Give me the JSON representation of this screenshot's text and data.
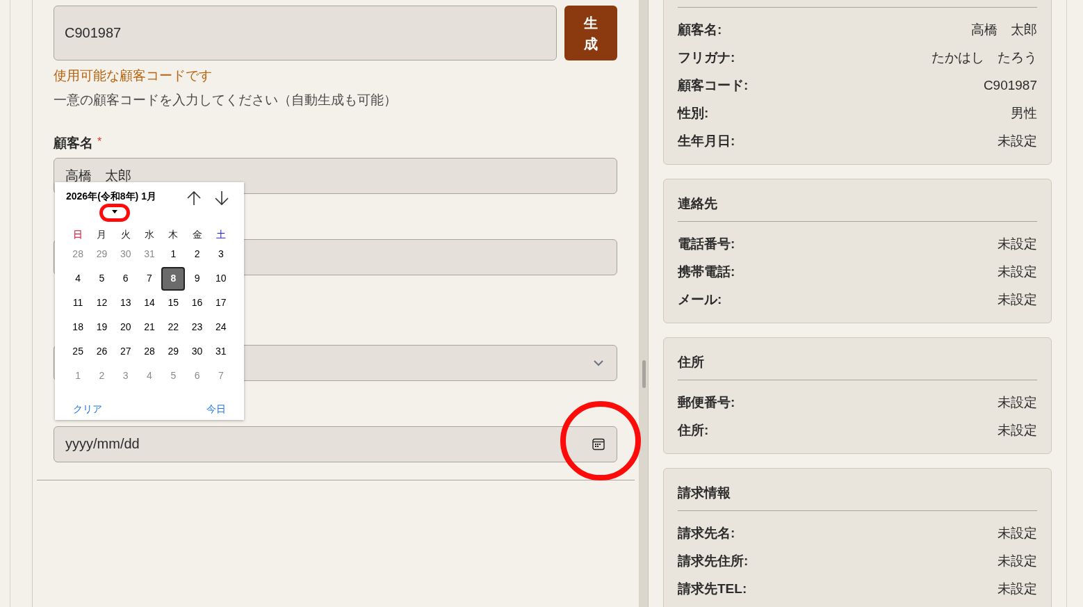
{
  "customer_code": {
    "value": "C901987",
    "generate_button": "生成",
    "status": "使用可能な顧客コードです",
    "help": "一意の顧客コードを入力してください（自動生成も可能）"
  },
  "customer_name": {
    "label": "顧客名",
    "required_mark": "*",
    "value": "高橋　太郎"
  },
  "fields": [
    {
      "kind": "text"
    },
    {
      "kind": "select"
    },
    {
      "kind": "date",
      "placeholder": "yyyy/mm/dd"
    }
  ],
  "calendar": {
    "header": "2026年(令和8年) 1月",
    "weekdays": [
      {
        "label": "日",
        "color": "#e0002b"
      },
      {
        "label": "月"
      },
      {
        "label": "火"
      },
      {
        "label": "水"
      },
      {
        "label": "木"
      },
      {
        "label": "金"
      },
      {
        "label": "土",
        "color": "#1a1aff"
      }
    ],
    "weeks": [
      [
        {
          "day": "28",
          "outside": true,
          "selected": false
        },
        {
          "day": "29",
          "outside": true,
          "selected": false
        },
        {
          "day": "30",
          "outside": true,
          "selected": false
        },
        {
          "day": "31",
          "outside": true,
          "selected": false
        },
        {
          "day": "1",
          "outside": false,
          "selected": false
        },
        {
          "day": "2",
          "outside": false,
          "selected": false
        },
        {
          "day": "3",
          "outside": false,
          "selected": false
        }
      ],
      [
        {
          "day": "4",
          "outside": false,
          "selected": false
        },
        {
          "day": "5",
          "outside": false,
          "selected": false
        },
        {
          "day": "6",
          "outside": false,
          "selected": false
        },
        {
          "day": "7",
          "outside": false,
          "selected": false
        },
        {
          "day": "8",
          "outside": false,
          "selected": true
        },
        {
          "day": "9",
          "outside": false,
          "selected": false
        },
        {
          "day": "10",
          "outside": false,
          "selected": false
        }
      ],
      [
        {
          "day": "11",
          "outside": false,
          "selected": false
        },
        {
          "day": "12",
          "outside": false,
          "selected": false
        },
        {
          "day": "13",
          "outside": false,
          "selected": false
        },
        {
          "day": "14",
          "outside": false,
          "selected": false
        },
        {
          "day": "15",
          "outside": false,
          "selected": false
        },
        {
          "day": "16",
          "outside": false,
          "selected": false
        },
        {
          "day": "17",
          "outside": false,
          "selected": false
        }
      ],
      [
        {
          "day": "18",
          "outside": false,
          "selected": false
        },
        {
          "day": "19",
          "outside": false,
          "selected": false
        },
        {
          "day": "20",
          "outside": false,
          "selected": false
        },
        {
          "day": "21",
          "outside": false,
          "selected": false
        },
        {
          "day": "22",
          "outside": false,
          "selected": false
        },
        {
          "day": "23",
          "outside": false,
          "selected": false
        },
        {
          "day": "24",
          "outside": false,
          "selected": false
        }
      ],
      [
        {
          "day": "25",
          "outside": false,
          "selected": false
        },
        {
          "day": "26",
          "outside": false,
          "selected": false
        },
        {
          "day": "27",
          "outside": false,
          "selected": false
        },
        {
          "day": "28",
          "outside": false,
          "selected": false
        },
        {
          "day": "29",
          "outside": false,
          "selected": false
        },
        {
          "day": "30",
          "outside": false,
          "selected": false
        },
        {
          "day": "31",
          "outside": false,
          "selected": false
        }
      ],
      [
        {
          "day": "1",
          "outside": true,
          "selected": false
        },
        {
          "day": "2",
          "outside": true,
          "selected": false
        },
        {
          "day": "3",
          "outside": true,
          "selected": false
        },
        {
          "day": "4",
          "outside": true,
          "selected": false
        },
        {
          "day": "5",
          "outside": true,
          "selected": false
        },
        {
          "day": "6",
          "outside": true,
          "selected": false
        },
        {
          "day": "7",
          "outside": true,
          "selected": false
        }
      ]
    ],
    "clear": "クリア",
    "today": "今日"
  },
  "summary_cards": [
    {
      "rows": [
        {
          "label": "顧客名:",
          "value": "高橋　太郎"
        },
        {
          "label": "フリガナ:",
          "value": "たかはし　たろう"
        },
        {
          "label": "顧客コード:",
          "value": "C901987"
        },
        {
          "label": "性別:",
          "value": "男性"
        },
        {
          "label": "生年月日:",
          "value": "未設定"
        }
      ]
    },
    {
      "title": "連絡先",
      "rows": [
        {
          "label": "電話番号:",
          "value": "未設定"
        },
        {
          "label": "携帯電話:",
          "value": "未設定"
        },
        {
          "label": "メール:",
          "value": "未設定"
        }
      ]
    },
    {
      "title": "住所",
      "rows": [
        {
          "label": "郵便番号:",
          "value": "未設定"
        },
        {
          "label": "住所:",
          "value": "未設定"
        }
      ]
    },
    {
      "title": "請求情報",
      "rows": [
        {
          "label": "請求先名:",
          "value": "未設定"
        },
        {
          "label": "請求先住所:",
          "value": "未設定"
        },
        {
          "label": "請求先TEL:",
          "value": "未設定"
        }
      ]
    }
  ]
}
